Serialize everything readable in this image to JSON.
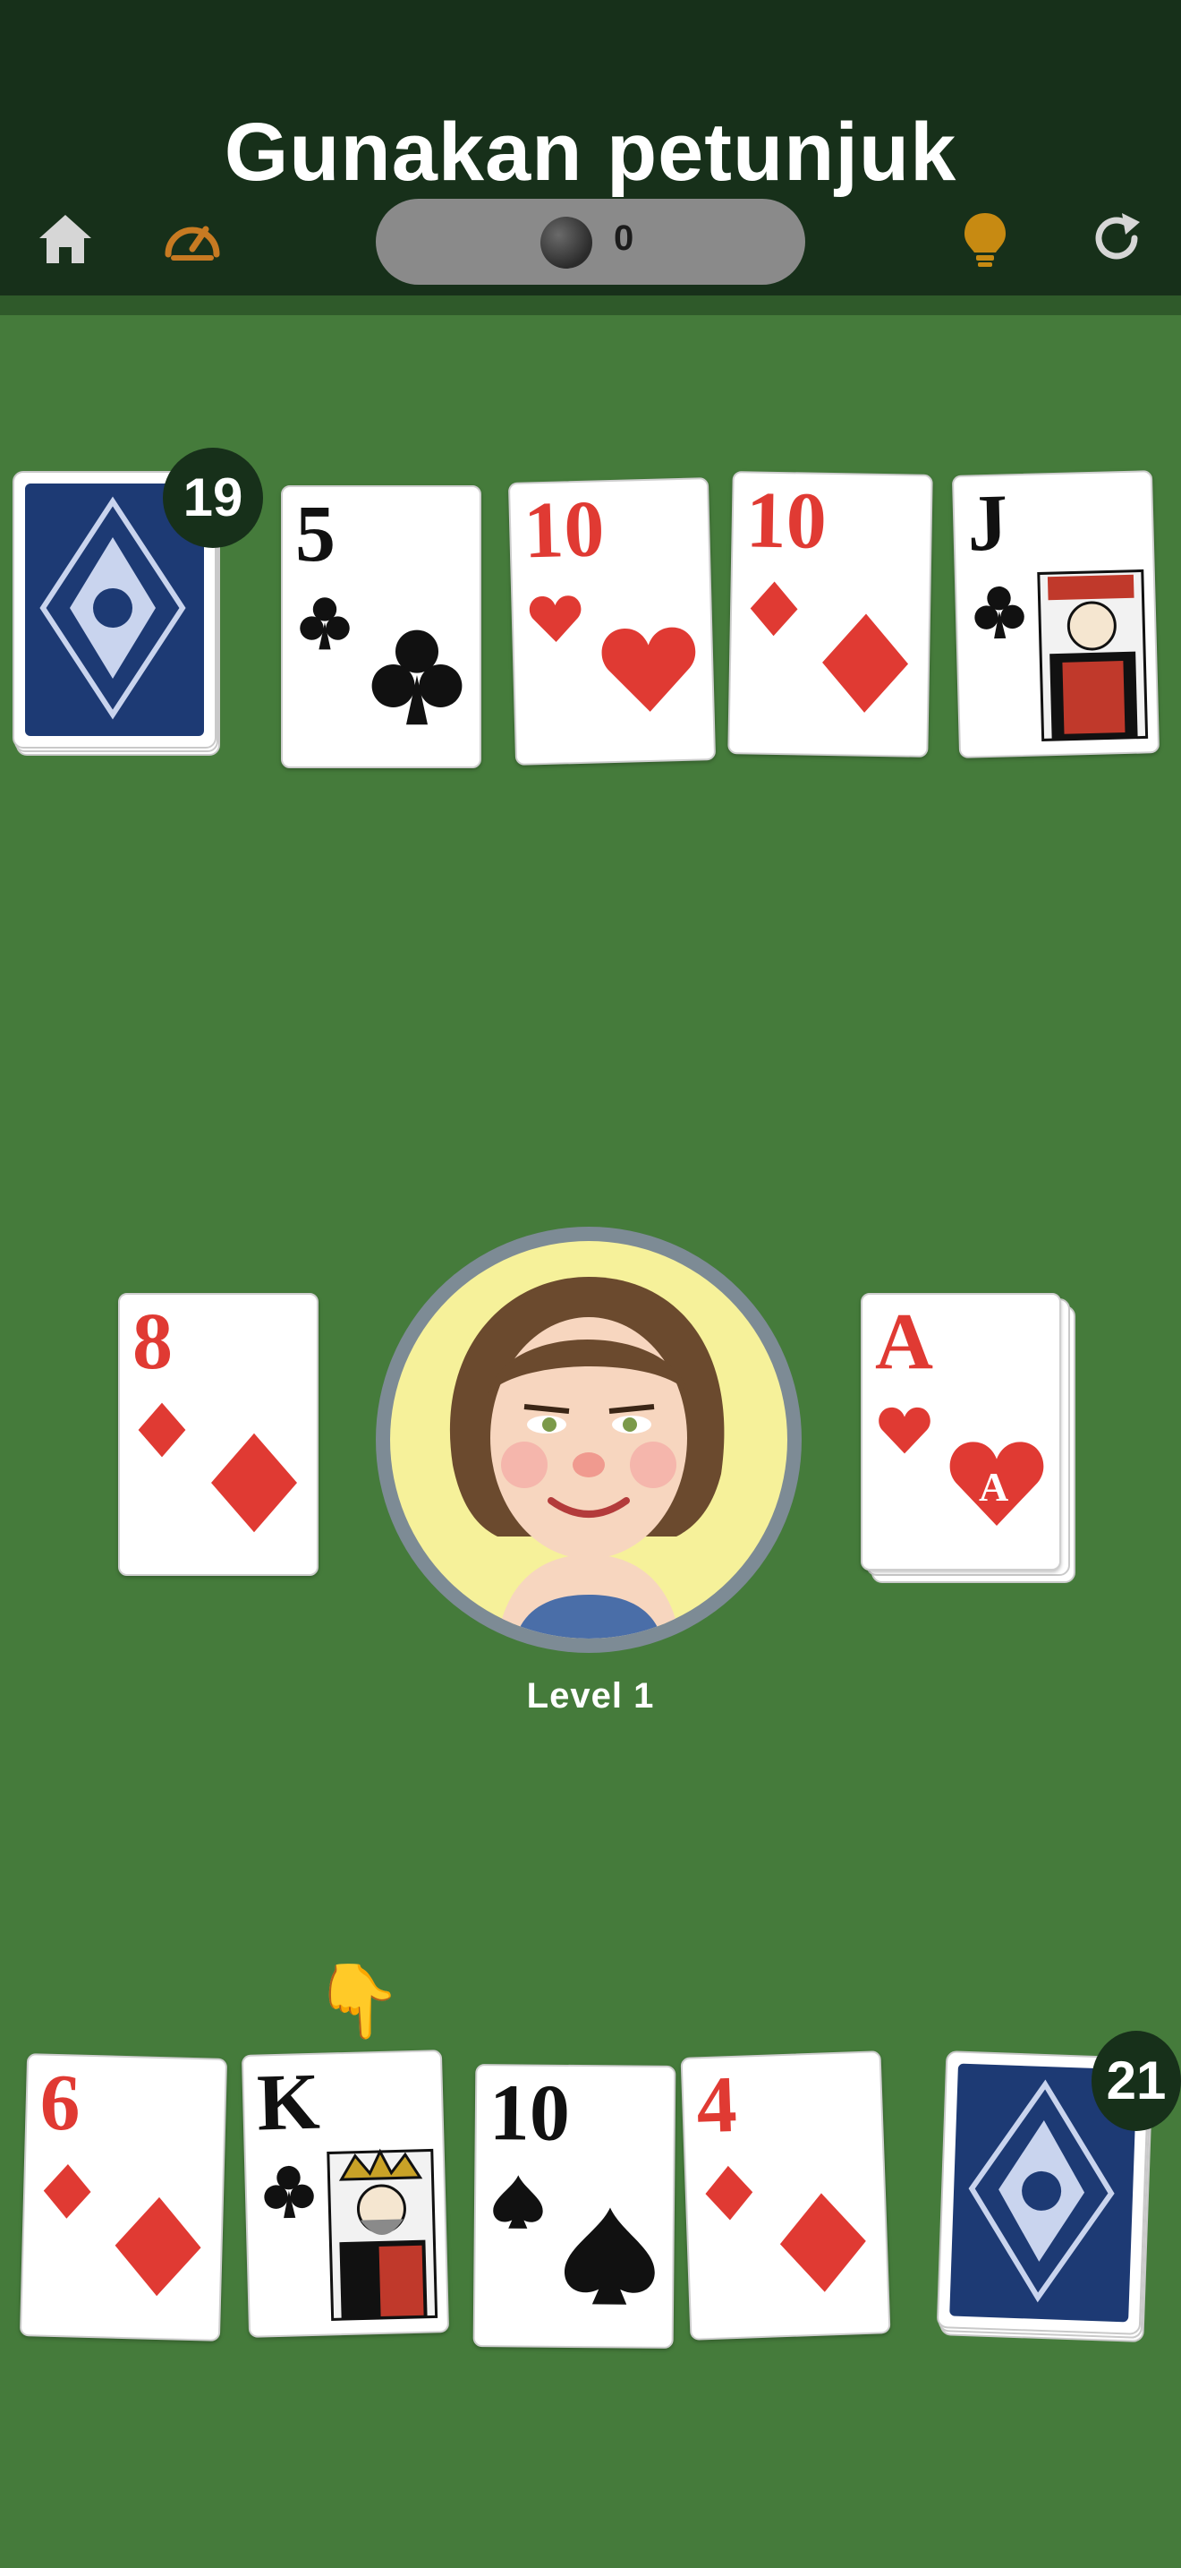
{
  "header": {
    "title": "Gunakan petunjuk",
    "coins": "0",
    "icons": [
      "home-icon",
      "speedometer-icon",
      "coin-icon",
      "lightbulb-icon",
      "refresh-icon"
    ]
  },
  "opponent": {
    "deck_count": "19",
    "cards": [
      {
        "rank": "5",
        "suit": "clubs",
        "color": "black"
      },
      {
        "rank": "10",
        "suit": "hearts",
        "color": "red"
      },
      {
        "rank": "10",
        "suit": "diamonds",
        "color": "red"
      },
      {
        "rank": "J",
        "suit": "clubs",
        "color": "black"
      }
    ]
  },
  "center": {
    "left_card": {
      "rank": "8",
      "suit": "diamonds",
      "color": "red"
    },
    "right_pile": {
      "rank": "A",
      "suit": "hearts",
      "color": "red",
      "center_letter": "A"
    },
    "level_label": "Level 1"
  },
  "player": {
    "deck_count": "21",
    "hint": "pointing-hand-icon",
    "cards": [
      {
        "rank": "6",
        "suit": "diamonds",
        "color": "red"
      },
      {
        "rank": "K",
        "suit": "clubs",
        "color": "black"
      },
      {
        "rank": "10",
        "suit": "spades",
        "color": "black"
      },
      {
        "rank": "4",
        "suit": "diamonds",
        "color": "red"
      }
    ]
  },
  "colors": {
    "felt": "#457b3b",
    "header": "#17301a",
    "red_suit": "#e03a33",
    "card_back": "#1d3a74"
  }
}
